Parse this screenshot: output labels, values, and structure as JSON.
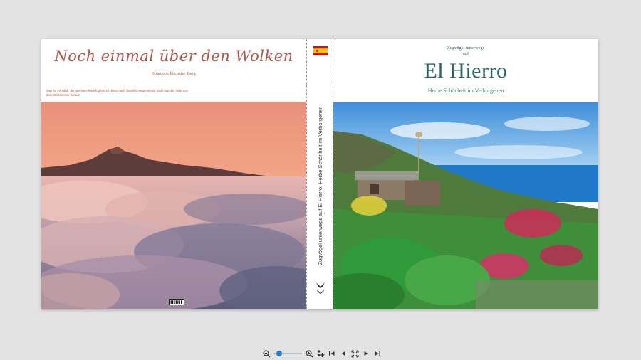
{
  "back_cover": {
    "title": "Noch einmal über den Wolken",
    "subtitle": "Spaniens höchster Berg",
    "blurb": "Was für ein Blick, der uns beim Rückflug von El Hierro nach Teneriffa vergönnt war: stolz ragt der Teide aus dem Wolkenmeer heraus.",
    "barcode_text": "▌▌▌▌▌▌▌"
  },
  "spine": {
    "text": "Zugvögel unterwegs auf El Hierro: Herbe Schönheit im Verborgenen",
    "flag_icon": "spain-flag-icon",
    "logo_icon": "bird-icon"
  },
  "front_cover": {
    "kicker_line1": "Zugvögel unterwegs",
    "kicker_line2": "auf",
    "title": "El Hierro",
    "tagline": "Herbe Schönheit im Verborgenen"
  },
  "toolbar": {
    "zoom_level": 0.2,
    "buttons": [
      "zoom-out-icon",
      "zoom-in-icon",
      "add-page-icon",
      "first-page-icon",
      "previous-page-icon",
      "fit-screen-icon",
      "next-page-icon",
      "last-page-icon"
    ]
  },
  "colors": {
    "background": "#e3e3e3",
    "back_title": "#b1574a",
    "front_title": "#2a6766",
    "accent_blue": "#2b7fc7"
  }
}
